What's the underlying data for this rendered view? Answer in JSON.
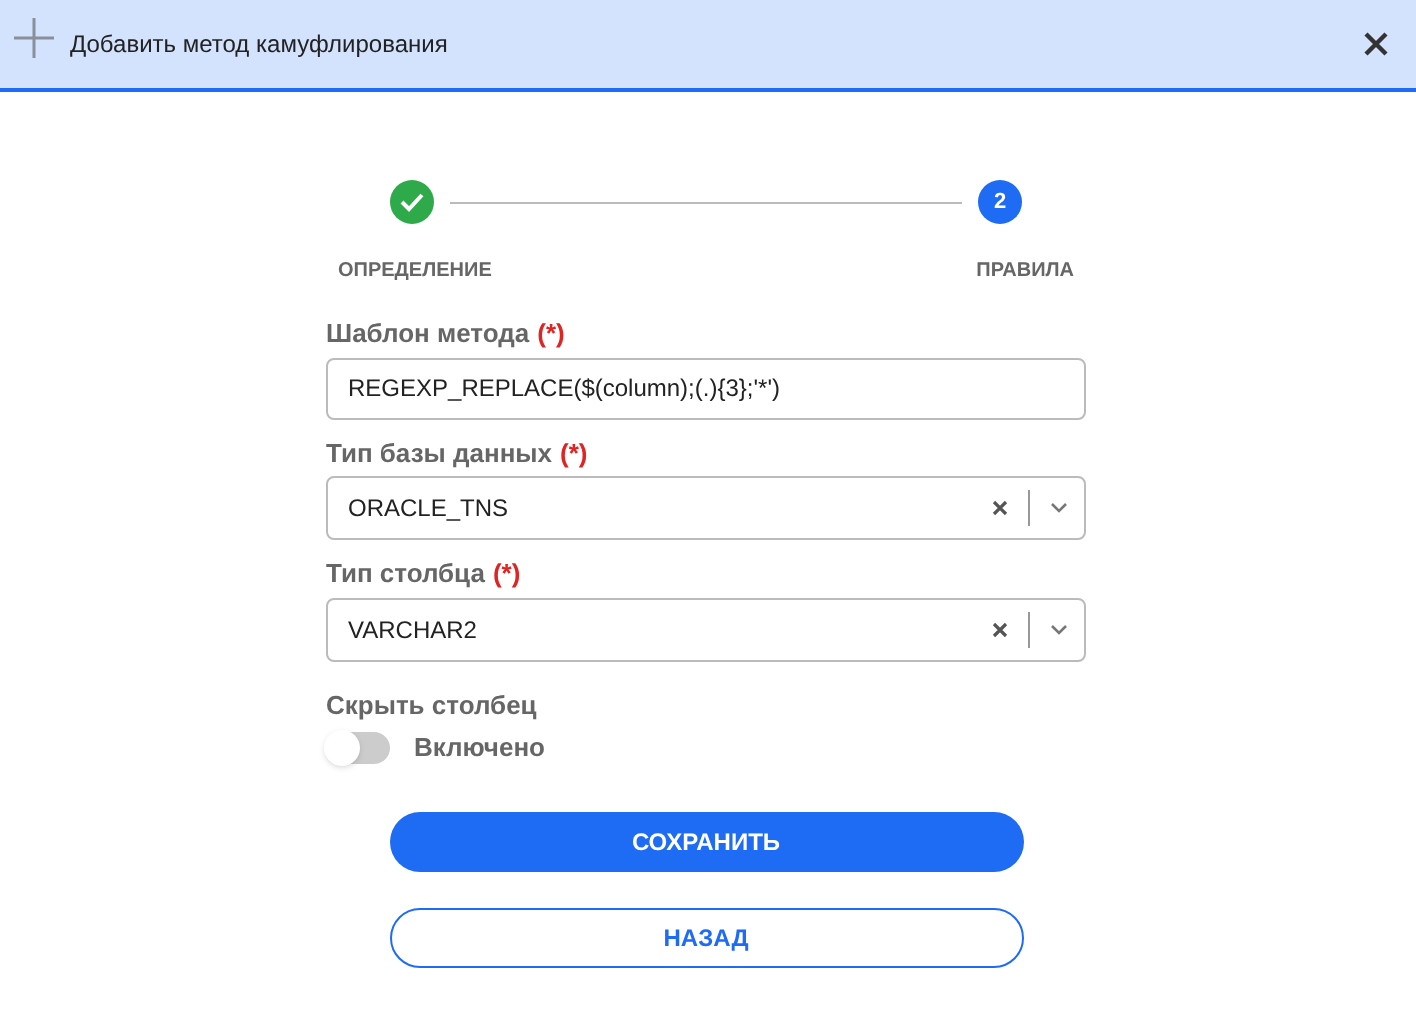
{
  "window": {
    "title": "Добавить метод камуфлирования"
  },
  "steps": [
    {
      "label": "ОПРЕДЕЛЕНИЕ",
      "completed": true
    },
    {
      "label": "ПРАВИЛА",
      "completed": false,
      "number": "2"
    }
  ],
  "fields": [
    {
      "kind": "text",
      "label": "Шаблон метода",
      "required_mark": "(*)",
      "value": "REGEXP_REPLACE($(column);(.){3};'*')"
    },
    {
      "kind": "select",
      "label": "Тип базы данных",
      "required_mark": "(*)",
      "value": "ORACLE_TNS"
    },
    {
      "kind": "select",
      "label": "Тип столбца",
      "required_mark": "(*)",
      "value": "VARCHAR2"
    }
  ],
  "hide_column": {
    "label": "Скрыть столбец",
    "toggle_label": "Включено",
    "on": false
  },
  "buttons": [
    {
      "label": "СОХРАНИТЬ",
      "kind": "primary"
    },
    {
      "label": "НАЗАД",
      "kind": "outline"
    }
  ]
}
